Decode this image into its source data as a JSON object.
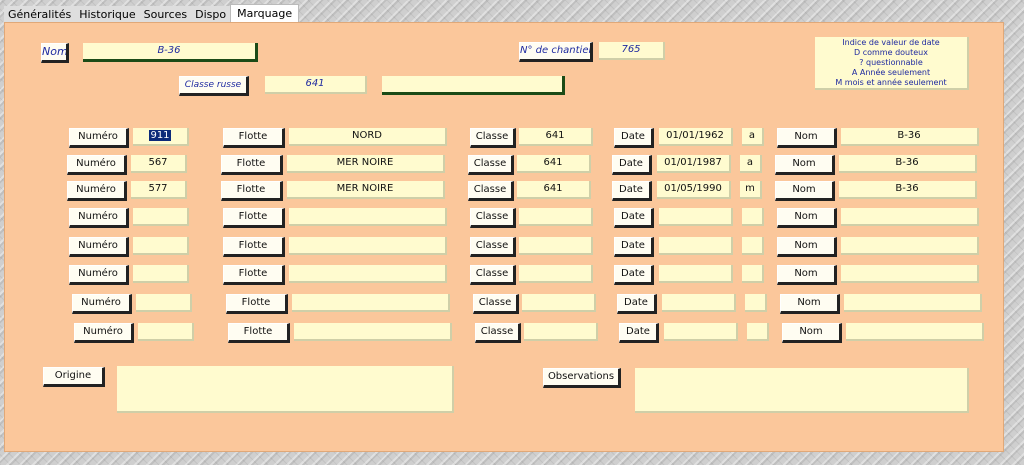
{
  "tabs": [
    "Généralités",
    "Historique",
    "Sources",
    "Dispo",
    "Marquage"
  ],
  "header": {
    "nom_label": "Nom",
    "nom_value": "B-36",
    "chantier_label": "N° de chantier",
    "chantier_value": "765",
    "classe_russe_label": "Classe russe",
    "classe_russe_value": "641",
    "classe_russe_extra": ""
  },
  "legend": [
    "Indice de valeur de date",
    "D comme douteux",
    "? questionnable",
    "A Année seulement",
    "M mois et année seulement"
  ],
  "row_labels": {
    "numero": "Numéro",
    "flotte": "Flotte",
    "classe": "Classe",
    "date": "Date",
    "nom": "Nom"
  },
  "rows": [
    {
      "numero": "911",
      "flotte": "NORD",
      "classe": "641",
      "date": "01/01/1962",
      "indice": "a",
      "nom": "B-36"
    },
    {
      "numero": "567",
      "flotte": "MER NOIRE",
      "classe": "641",
      "date": "01/01/1987",
      "indice": "a",
      "nom": "B-36"
    },
    {
      "numero": "577",
      "flotte": "MER NOIRE",
      "classe": "641",
      "date": "01/05/1990",
      "indice": "m",
      "nom": "B-36"
    },
    {
      "numero": "",
      "flotte": "",
      "classe": "",
      "date": "",
      "indice": "",
      "nom": ""
    },
    {
      "numero": "",
      "flotte": "",
      "classe": "",
      "date": "",
      "indice": "",
      "nom": ""
    },
    {
      "numero": "",
      "flotte": "",
      "classe": "",
      "date": "",
      "indice": "",
      "nom": ""
    },
    {
      "numero": "",
      "flotte": "",
      "classe": "",
      "date": "",
      "indice": "",
      "nom": ""
    },
    {
      "numero": "",
      "flotte": "",
      "classe": "",
      "date": "",
      "indice": "",
      "nom": ""
    }
  ],
  "footer": {
    "origine_label": "Origine",
    "origine_value": "",
    "observations_label": "Observations",
    "observations_value": ""
  }
}
